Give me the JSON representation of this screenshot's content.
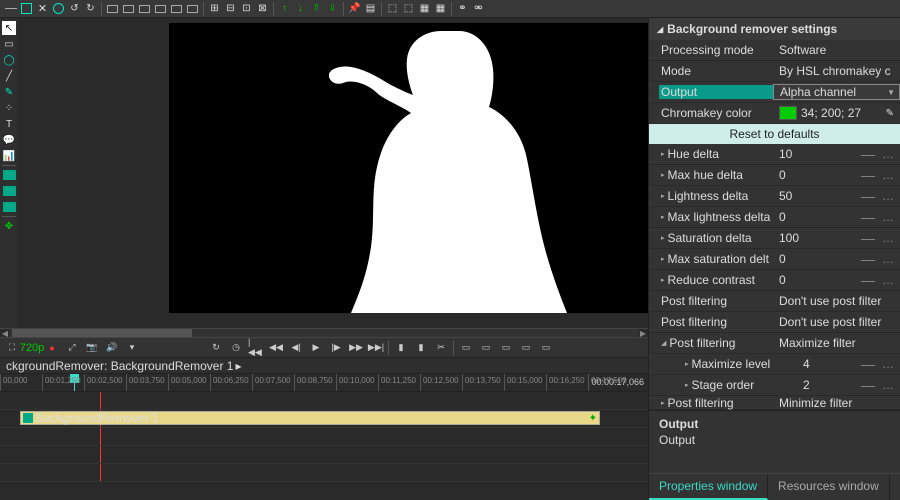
{
  "panel": {
    "title": "Background remover settings",
    "rows": [
      {
        "label": "Processing mode",
        "value": "Software",
        "type": "text"
      },
      {
        "label": "Mode",
        "value": "By HSL chromakey c",
        "type": "text"
      },
      {
        "label": "Output",
        "value": "Alpha channel",
        "type": "dropdown",
        "highlight": true
      },
      {
        "label": "Chromakey color",
        "value": "34; 200; 27",
        "type": "color"
      }
    ],
    "reset": "Reset to defaults",
    "params": [
      {
        "label": "Hue delta",
        "value": "10",
        "exp": true
      },
      {
        "label": "Max hue delta",
        "value": "0",
        "exp": true
      },
      {
        "label": "Lightness delta",
        "value": "50",
        "exp": true
      },
      {
        "label": "Max lightness delta",
        "value": "0",
        "exp": true
      },
      {
        "label": "Saturation delta",
        "value": "100",
        "exp": true
      },
      {
        "label": "Max saturation delt",
        "value": "0",
        "exp": true
      },
      {
        "label": "Reduce contrast",
        "value": "0",
        "exp": true
      },
      {
        "label": "Post filtering",
        "value": "Don't use post filter"
      },
      {
        "label": "Post filtering",
        "value": "Don't use post filter"
      },
      {
        "label": "Post filtering",
        "value": "Maximize filter",
        "open": true
      },
      {
        "label": "Maximize level",
        "value": "4",
        "sub": true,
        "exp": true
      },
      {
        "label": "Stage order",
        "value": "2",
        "sub": true
      },
      {
        "label": "Post filtering",
        "value": "Minimize filter",
        "exp": true,
        "cut": true
      }
    ],
    "out_title": "Output",
    "out_val": "Output"
  },
  "tabs": {
    "a": "Properties window",
    "b": "Resources window"
  },
  "transport": {
    "res": "720p"
  },
  "crumb": "ckgroundRemover: BackgroundRemover 1",
  "ruler": [
    "00,000",
    "00:01,250",
    "00:02,500",
    "00:03,750",
    "00:05,000",
    "00:06,250",
    "00:07,500",
    "00:08,750",
    "00:10,000",
    "00:11,250",
    "00:12,500",
    "00:13,750",
    "00:15,000",
    "00:16,250",
    "00:17,500"
  ],
  "ruler_end": "00:00:17,066",
  "clip": "BackgroundRemover 1"
}
